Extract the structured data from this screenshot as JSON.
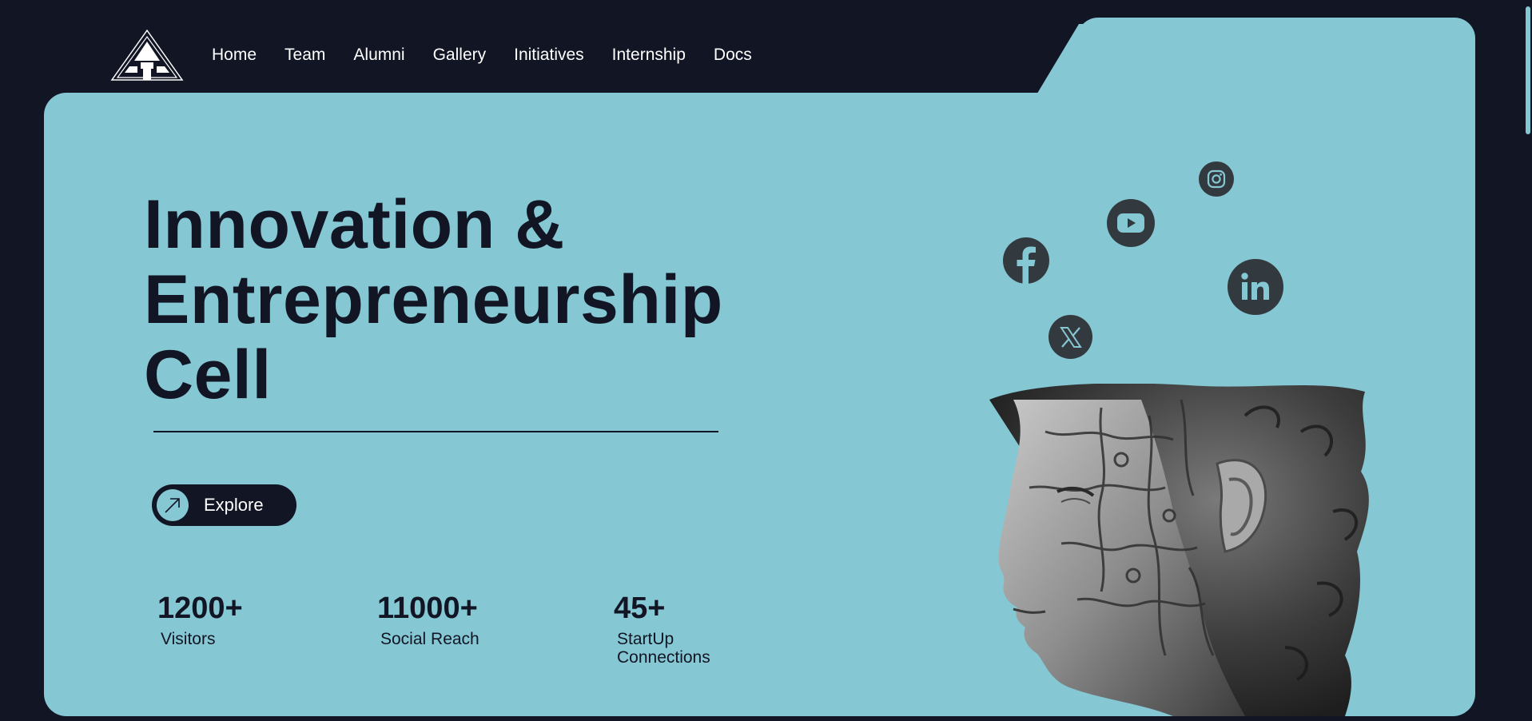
{
  "colors": {
    "background": "#111524",
    "card": "#85c7d3",
    "text_dark": "#111524",
    "text_light": "#ffffff",
    "social_bg": "#333a3f"
  },
  "logo": {
    "icon": "ecell-triangle-logo-icon"
  },
  "nav": {
    "items": [
      {
        "label": "Home"
      },
      {
        "label": "Team"
      },
      {
        "label": "Alumni"
      },
      {
        "label": "Gallery"
      },
      {
        "label": "Initiatives"
      },
      {
        "label": "Internship"
      },
      {
        "label": "Docs"
      }
    ]
  },
  "hero": {
    "title_lines": [
      "Innovation &",
      "Entrepreneurship",
      "Cell"
    ],
    "explore_label": "Explore",
    "explore_icon": "arrow-up-right-icon"
  },
  "stats": [
    {
      "value": "1200+",
      "label": "Visitors"
    },
    {
      "value": "11000+",
      "label": "Social Reach"
    },
    {
      "value": "45+",
      "label": "StartUp Connections"
    }
  ],
  "social": {
    "instagram_icon": "instagram-icon",
    "youtube_icon": "youtube-icon",
    "facebook_icon": "facebook-icon",
    "linkedin_icon": "linkedin-icon",
    "x_icon": "x-twitter-icon"
  },
  "illustration": {
    "icon": "puzzle-head-illustration"
  }
}
